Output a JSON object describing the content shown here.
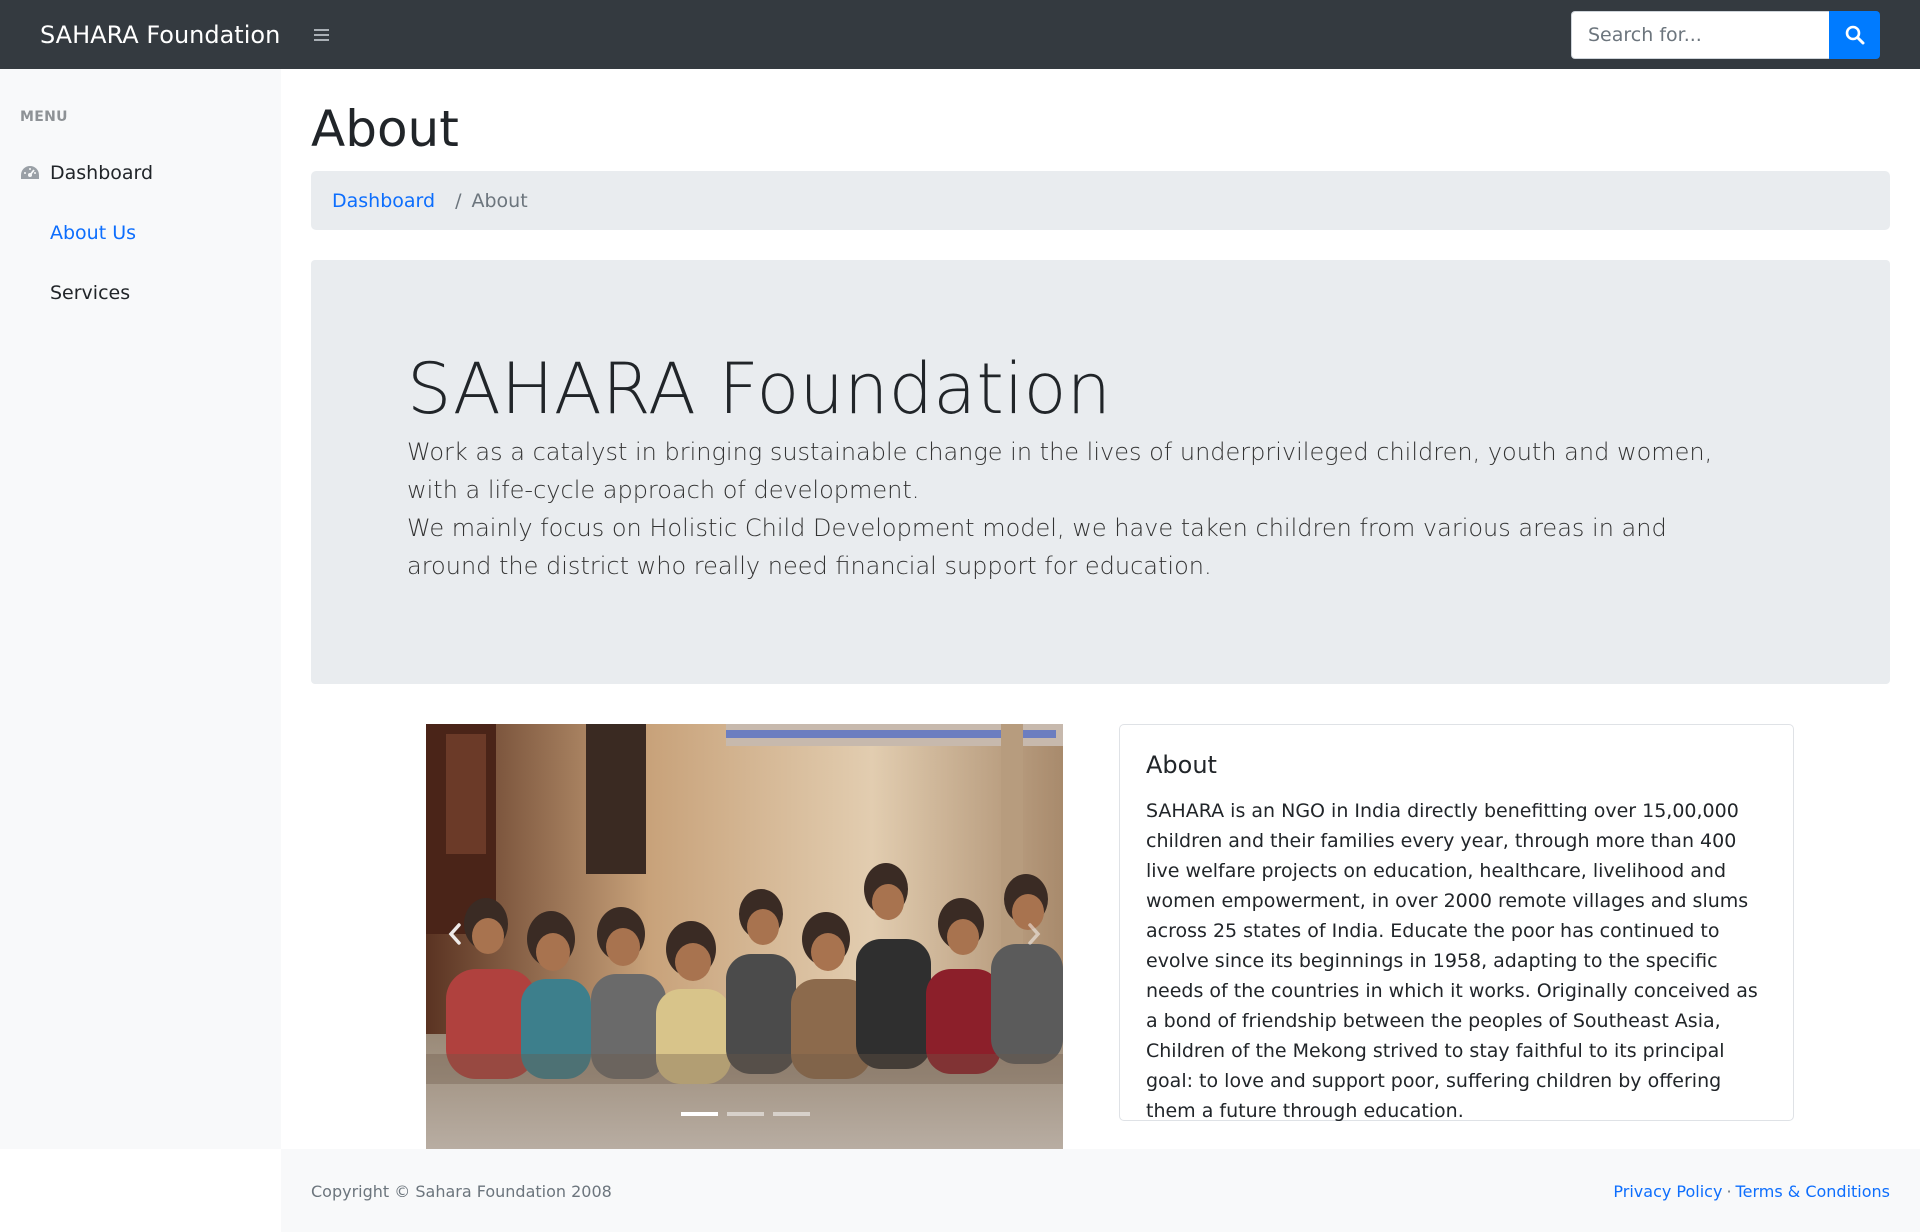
{
  "navbar": {
    "brand": "SAHARA Foundation",
    "toggle_icon": "hamburger-icon",
    "search_placeholder": "Search for...",
    "search_icon": "search-icon",
    "bg_color": "#343a40",
    "search_button_color": "#007bff"
  },
  "sidebar": {
    "heading": "MENU",
    "items": [
      {
        "label": "Dashboard",
        "icon": "tachometer-icon",
        "active": false
      },
      {
        "label": "About Us",
        "active": true
      },
      {
        "label": "Services",
        "active": false
      }
    ]
  },
  "main": {
    "title": "About",
    "breadcrumb": {
      "link": "Dashboard",
      "separator": "/",
      "current": "About"
    },
    "jumbotron": {
      "title": "SAHARA Foundation",
      "line1": "Work as a catalyst in bringing sustainable change in the lives of underprivileged children, youth and women, with a life-cycle approach of development.",
      "line2": "We mainly focus on Holistic Child Development model, we have taken children from various areas in and around the district who really need financial support for education."
    },
    "carousel": {
      "prev_icon": "chevron-left-icon",
      "next_icon": "chevron-right-icon",
      "slides": 3,
      "active_slide": 1
    },
    "card": {
      "title": "About",
      "text": "SAHARA is an NGO in India directly benefitting over 15,00,000 children and their families every year, through more than 400 live welfare projects on education, healthcare, livelihood and women empowerment, in over 2000 remote villages and slums across 25 states of India. Educate the poor has continued to evolve since its beginnings in 1958, adapting to the specific needs of the countries in which it works. Originally conceived as a bond of friendship between the peoples of Southeast Asia, Children of the Mekong strived to stay faithful to its principal goal: to love and support poor, suffering children by offering them a future through education."
    }
  },
  "footer": {
    "copyright": "Copyright © Sahara Foundation 2008",
    "privacy": "Privacy Policy",
    "separator": "·",
    "terms": "Terms & Conditions"
  },
  "colors": {
    "link": "#0d6efd",
    "sidebar_bg": "#f8f9fa",
    "jumbotron_bg": "#e9ecef"
  }
}
